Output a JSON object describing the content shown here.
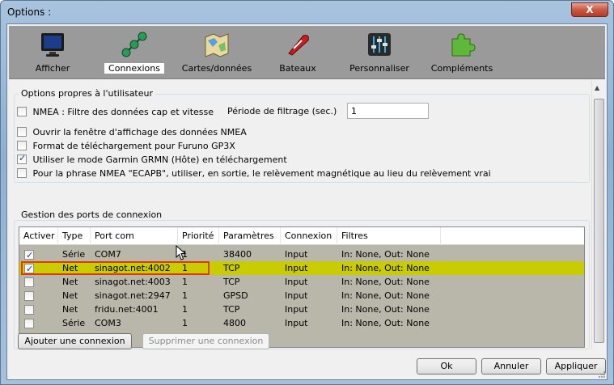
{
  "window": {
    "title": "Options :",
    "close_glyph": "X"
  },
  "toolbar": {
    "items": [
      {
        "label": "Afficher",
        "icon": "monitor-icon"
      },
      {
        "label": "Connexions",
        "icon": "network-icon",
        "active": true
      },
      {
        "label": "Cartes/données",
        "icon": "charts-icon"
      },
      {
        "label": "Bateaux",
        "icon": "boat-icon"
      },
      {
        "label": "Personnaliser",
        "icon": "sliders-icon"
      },
      {
        "label": "Compléments",
        "icon": "puzzle-icon"
      }
    ]
  },
  "user_options": {
    "group_label": "Options propres à l'utilisateur",
    "nmea_filter": {
      "label": "NMEA : Filtre des données cap et vitesse",
      "checked": false
    },
    "filter_period_label": "Période de filtrage (sec.)",
    "filter_period_value": "1",
    "open_nmea_window": {
      "label": "Ouvrir la fenêtre d'affichage des données NMEA",
      "checked": false
    },
    "furuno_format": {
      "label": "Format de téléchargement pour Furuno GP3X",
      "checked": false
    },
    "garmin_mode": {
      "label": "Utiliser le mode Garmin GRMN (Hôte) en téléchargement",
      "checked": true
    },
    "ecapb": {
      "label": "Pour la phrase NMEA \"ECAPB\", utiliser, en sortie, le relèvement magnétique  au lieu du relèvement vrai",
      "checked": false
    }
  },
  "ports": {
    "group_label": "Gestion des ports de connexion",
    "columns": [
      "Activer",
      "Type",
      "Port com",
      "Priorité",
      "Paramètres",
      "Connexion",
      "Filtres"
    ],
    "rows": [
      {
        "active": true,
        "type": "Série",
        "port": "COM7",
        "priority": "1",
        "params": "38400",
        "connection": "Input",
        "filters": "In: None, Out: None"
      },
      {
        "active": true,
        "type": "Net",
        "port": "sinagot.net:4002",
        "priority": "1",
        "params": "TCP",
        "connection": "Input",
        "filters": "In: None, Out: None",
        "selected": true
      },
      {
        "active": false,
        "type": "Net",
        "port": "sinagot.net:4003",
        "priority": "1",
        "params": "TCP",
        "connection": "Input",
        "filters": "In: None, Out: None"
      },
      {
        "active": false,
        "type": "Net",
        "port": "sinagot.net:2947",
        "priority": "1",
        "params": "GPSD",
        "connection": "Input",
        "filters": "In: None, Out: None"
      },
      {
        "active": false,
        "type": "Net",
        "port": "fridu.net:4001",
        "priority": "1",
        "params": "TCP",
        "connection": "Input",
        "filters": "In: None, Out: None"
      },
      {
        "active": false,
        "type": "Série",
        "port": "COM3",
        "priority": "1",
        "params": "4800",
        "connection": "Input",
        "filters": "In: None, Out: None"
      }
    ]
  },
  "buttons": {
    "add_connection": "Ajouter une connexion",
    "remove_connection": "Supprimer une connexion",
    "ok": "Ok",
    "cancel": "Annuler",
    "apply": "Appliquer"
  }
}
